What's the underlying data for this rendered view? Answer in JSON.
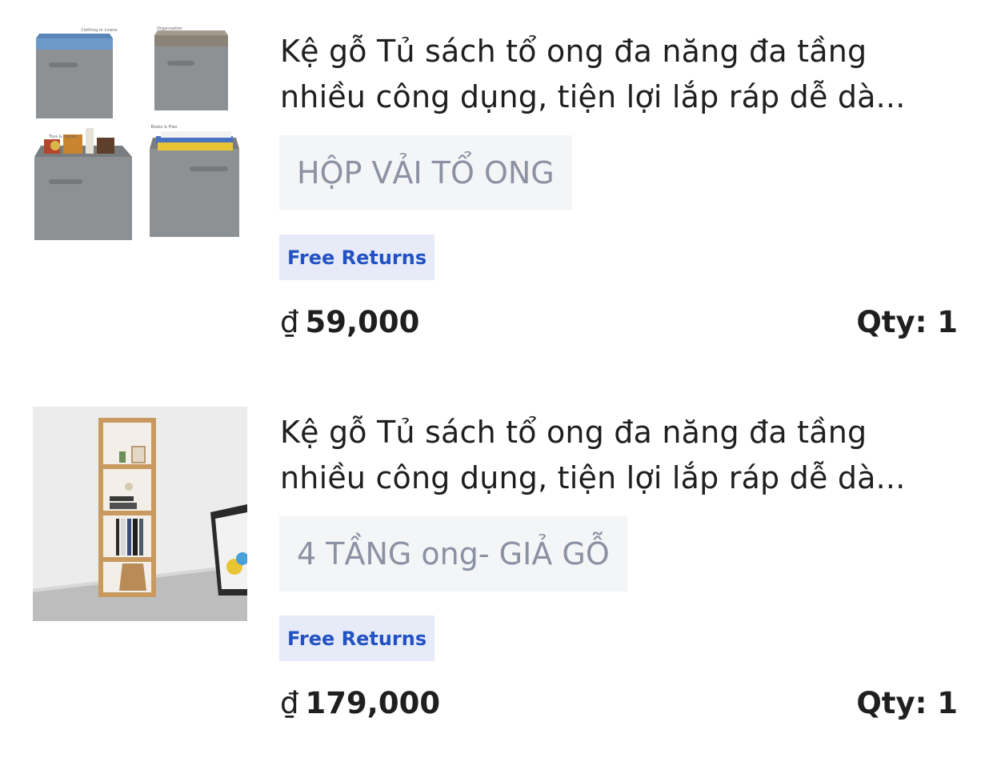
{
  "items": [
    {
      "title_line1": "Kệ gỗ Tủ sách tổ ong đa năng đa tầng",
      "title_line2": "nhiều công dụng, tiện lợi lắp ráp dễ dà...",
      "variant": "HỘP VẢI TỔ ONG",
      "badge": "Free Returns",
      "currency": "₫",
      "price": "59,000",
      "qty": "Qty: 1",
      "image": {
        "icon": "fabric-storage-boxes-image",
        "labels": [
          "Clothing or Linens",
          "Organization",
          "Toys & Games",
          "Books & Files"
        ]
      }
    },
    {
      "title_line1": "Kệ gỗ Tủ sách tổ ong đa năng đa tầng",
      "title_line2": "nhiều công dụng, tiện lợi lắp ráp dễ dà...",
      "variant": "4 TẦNG ong- GIẢ GỖ",
      "badge": "Free Returns",
      "currency": "₫",
      "price": "179,000",
      "qty": "Qty: 1",
      "image": {
        "icon": "wooden-bookshelf-image"
      }
    }
  ],
  "colors": {
    "text": "#1f1f1f",
    "variant_bg": "#f4f5f7",
    "variant_text": "#8c91a3",
    "badge_bg": "#e6ebf7",
    "badge_text": "#2352c4"
  }
}
